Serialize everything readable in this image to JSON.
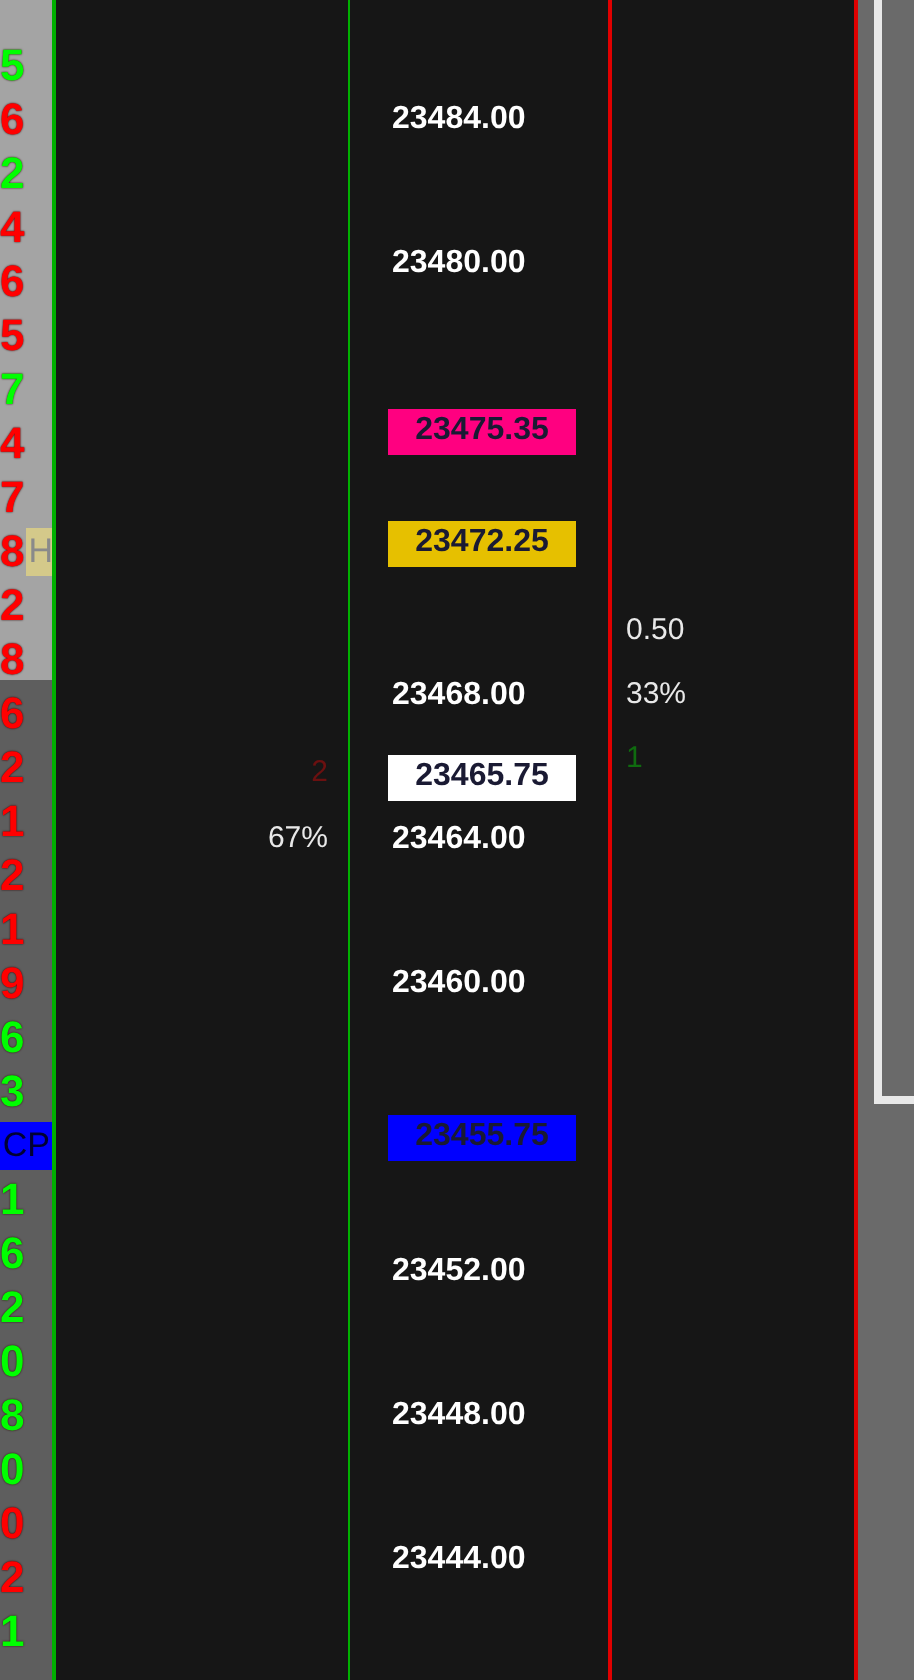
{
  "left_column": {
    "items": [
      {
        "text": "5",
        "color": "#00ff00"
      },
      {
        "text": "6",
        "color": "#ff0000"
      },
      {
        "text": "2",
        "color": "#00ff00"
      },
      {
        "text": "4",
        "color": "#ff0000"
      },
      {
        "text": "6",
        "color": "#ff0000"
      },
      {
        "text": "5",
        "color": "#ff0000"
      },
      {
        "text": "7",
        "color": "#00ff00"
      },
      {
        "text": "4",
        "color": "#ff0000"
      },
      {
        "text": "7",
        "color": "#ff0000"
      },
      {
        "text": "8",
        "color": "#ff0000",
        "tag": "H"
      },
      {
        "text": "2",
        "color": "#ff0000"
      },
      {
        "text": "8",
        "color": "#ff0000"
      },
      {
        "text": "6",
        "color": "#ff0000"
      },
      {
        "text": "2",
        "color": "#ff0000"
      },
      {
        "text": "1",
        "color": "#ff0000"
      },
      {
        "text": "2",
        "color": "#ff0000"
      },
      {
        "text": "1",
        "color": "#ff0000"
      },
      {
        "text": "9",
        "color": "#ff0000"
      },
      {
        "text": "6",
        "color": "#00ff00"
      },
      {
        "text": "3",
        "color": "#00ff00"
      },
      {
        "text": "CP",
        "color": "#0000ff",
        "kind": "tag"
      },
      {
        "text": "1",
        "color": "#00ff00"
      },
      {
        "text": "6",
        "color": "#00ff00"
      },
      {
        "text": "2",
        "color": "#00ff00"
      },
      {
        "text": "0",
        "color": "#00ff00"
      },
      {
        "text": "8",
        "color": "#00ff00"
      },
      {
        "text": "0",
        "color": "#00ff00"
      },
      {
        "text": "0",
        "color": "#ff0000"
      },
      {
        "text": "2",
        "color": "#ff0000"
      },
      {
        "text": "1",
        "color": "#00ff00"
      }
    ]
  },
  "left_stats": [
    {
      "text": "2",
      "color": "#6b1010"
    },
    {
      "text": "67%",
      "color": "#e8e8e8"
    }
  ],
  "price_axis": {
    "items": [
      {
        "text": "23484.00",
        "kind": "grid"
      },
      {
        "text": "23480.00",
        "kind": "grid"
      },
      {
        "text": "23475.35",
        "kind": "marker",
        "color": "#ff0080"
      },
      {
        "text": "23472.25",
        "kind": "marker",
        "color": "#e6c000"
      },
      {
        "text": "23468.00",
        "kind": "grid"
      },
      {
        "text": "23465.75",
        "kind": "marker",
        "color": "#ffffff"
      },
      {
        "text": "23464.00",
        "kind": "grid"
      },
      {
        "text": "23460.00",
        "kind": "grid"
      },
      {
        "text": "23455.75",
        "kind": "marker",
        "color": "#0000ff"
      },
      {
        "text": "23452.00",
        "kind": "grid"
      },
      {
        "text": "23448.00",
        "kind": "grid"
      },
      {
        "text": "23444.00",
        "kind": "grid"
      }
    ]
  },
  "right_stats": [
    {
      "text": "0.50",
      "color": "#e8e8e8"
    },
    {
      "text": "33%",
      "color": "#e8e8e8"
    },
    {
      "text": "1",
      "color": "#0f6b0f"
    }
  ]
}
